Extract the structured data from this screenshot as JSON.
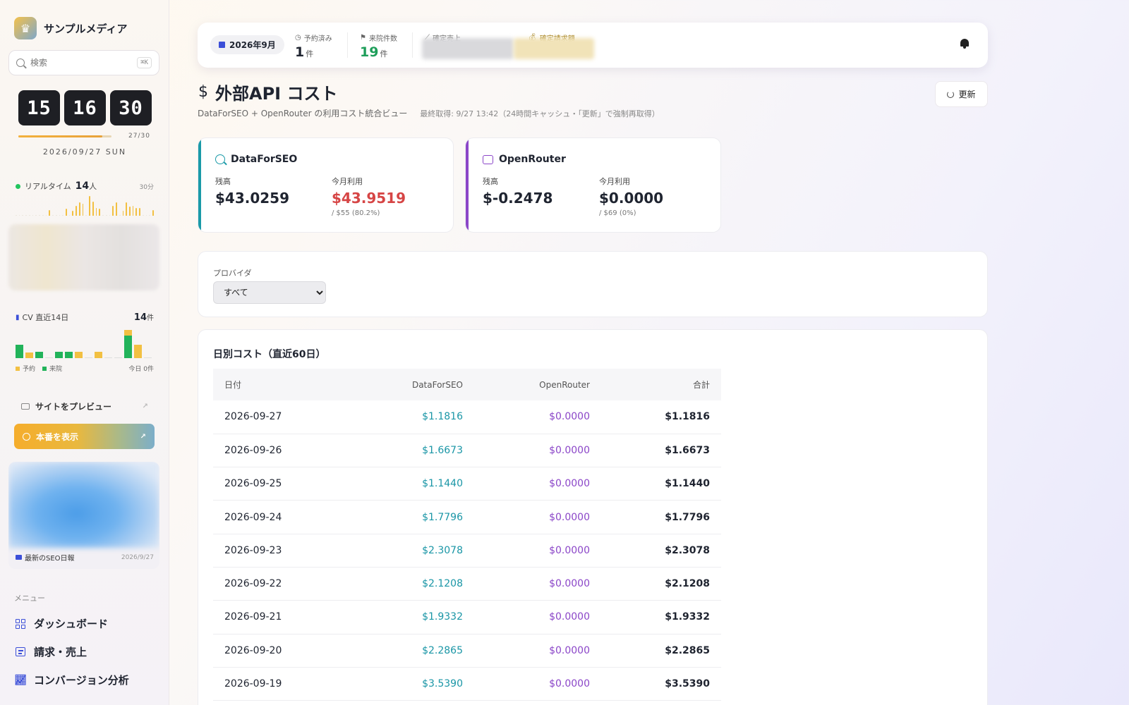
{
  "sidebar": {
    "brand_name": "サンプルメディア",
    "search_placeholder": "検索",
    "search_shortcut": "⌘K",
    "clock": {
      "hh": "15",
      "mm": "16",
      "ss": "30",
      "progress_label": "27/30",
      "progress_fraction": 0.9,
      "date": "2026/09/27 SUN"
    },
    "realtime": {
      "label": "リアルタイム",
      "count": "14",
      "unit": "人",
      "window": "30分",
      "bars": [
        0,
        0,
        0,
        0,
        0,
        0,
        0,
        0,
        0,
        0,
        4,
        0,
        0,
        0,
        0,
        5,
        0,
        3,
        8,
        11,
        10,
        0,
        17,
        12,
        6,
        5,
        0,
        0,
        0,
        8,
        11,
        0,
        3,
        11,
        7,
        8,
        6,
        6,
        0,
        0,
        0,
        4
      ]
    },
    "cv": {
      "label": "CV 直近14日",
      "count": "14",
      "unit": "件",
      "days": [
        {
          "g": 18,
          "y": 0
        },
        {
          "g": 0,
          "y": 8
        },
        {
          "g": 9,
          "y": 0
        },
        {
          "g": 0,
          "y": 0
        },
        {
          "g": 9,
          "y": 0
        },
        {
          "g": 9,
          "y": 0
        },
        {
          "g": 0,
          "y": 9
        },
        {
          "g": 0,
          "y": 0
        },
        {
          "g": 0,
          "y": 9
        },
        {
          "g": 0,
          "y": 0
        },
        {
          "g": 0,
          "y": 0
        },
        {
          "g": 30,
          "y": 8
        },
        {
          "g": 0,
          "y": 18
        },
        {
          "g": 0,
          "y": 0
        }
      ],
      "legend_reserve": "予約",
      "legend_visit": "来院",
      "today": "今日 0件",
      "color_reserve": "#f2c042",
      "color_visit": "#22b35a"
    },
    "preview_label": "サイトをプレビュー",
    "production_label": "本番を表示",
    "seo_report": {
      "label": "最新のSEO日報",
      "date": "2026/9/27"
    },
    "menu_label": "メニュー",
    "menu": [
      {
        "label": "ダッシュボード",
        "icon": "grid-icon"
      },
      {
        "label": "請求・売上",
        "icon": "invoice-icon"
      },
      {
        "label": "コンバージョン分析",
        "icon": "line-chart-icon"
      }
    ]
  },
  "topbar": {
    "month": "2026年9月",
    "reserved": {
      "label": "予約済み",
      "value": "1",
      "unit": "件"
    },
    "visits": {
      "label": "来院件数",
      "value": "19",
      "unit": "件"
    },
    "confirmed_sales": {
      "label": "確定売上"
    },
    "confirmed_billing": {
      "label": "確定請求額"
    }
  },
  "page": {
    "title": "外部API コスト",
    "subtitle": "DataForSEO + OpenRouter の利用コスト統合ビュー",
    "fetched": "最終取得: 9/27 13:42（24時間キャッシュ・「更新」で強制再取得）",
    "refresh_label": "更新"
  },
  "providers": [
    {
      "name": "DataForSEO",
      "balance_label": "残高",
      "balance": "$43.0259",
      "usage_label": "今月利用",
      "usage": "$43.9519",
      "usage_sub": "/ $55 (80.2%)",
      "accent": "#1a9aa8"
    },
    {
      "name": "OpenRouter",
      "balance_label": "残高",
      "balance": "$-0.2478",
      "usage_label": "今月利用",
      "usage": "$0.0000",
      "usage_sub": "/ $69 (0%)",
      "accent": "#8b46c8"
    }
  ],
  "filter": {
    "label": "プロバイダ",
    "selected": "すべて"
  },
  "daily": {
    "title": "日別コスト（直近60日）",
    "headers": {
      "date": "日付",
      "dfs": "DataForSEO",
      "or": "OpenRouter",
      "total": "合計"
    },
    "rows": [
      {
        "date": "2026-09-27",
        "dfs": "$1.1816",
        "or": "$0.0000",
        "total": "$1.1816"
      },
      {
        "date": "2026-09-26",
        "dfs": "$1.6673",
        "or": "$0.0000",
        "total": "$1.6673"
      },
      {
        "date": "2026-09-25",
        "dfs": "$1.1440",
        "or": "$0.0000",
        "total": "$1.1440"
      },
      {
        "date": "2026-09-24",
        "dfs": "$1.7796",
        "or": "$0.0000",
        "total": "$1.7796"
      },
      {
        "date": "2026-09-23",
        "dfs": "$2.3078",
        "or": "$0.0000",
        "total": "$2.3078"
      },
      {
        "date": "2026-09-22",
        "dfs": "$2.1208",
        "or": "$0.0000",
        "total": "$2.1208"
      },
      {
        "date": "2026-09-21",
        "dfs": "$1.9332",
        "or": "$0.0000",
        "total": "$1.9332"
      },
      {
        "date": "2026-09-20",
        "dfs": "$2.2865",
        "or": "$0.0000",
        "total": "$2.2865"
      },
      {
        "date": "2026-09-19",
        "dfs": "$3.5390",
        "or": "$0.0000",
        "total": "$3.5390"
      }
    ]
  }
}
